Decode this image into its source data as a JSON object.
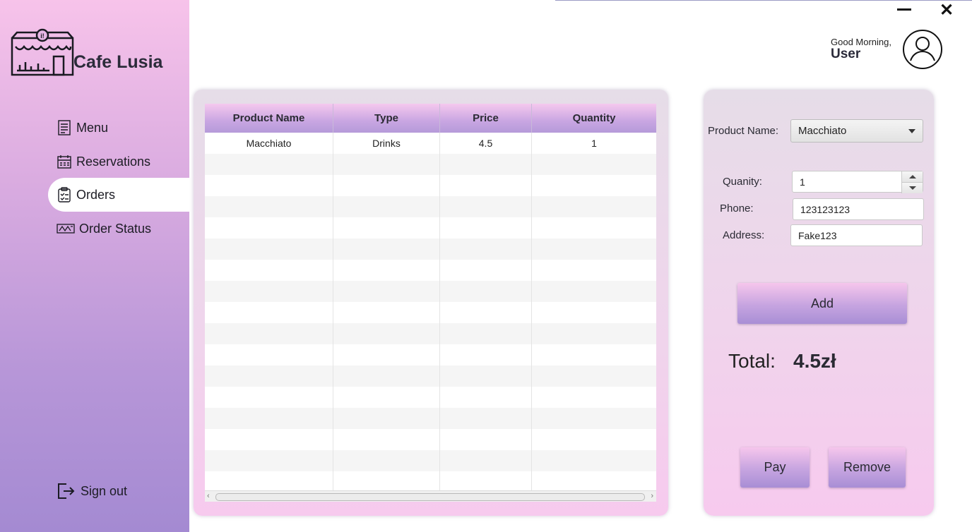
{
  "app": {
    "brand": "Cafe Lusia"
  },
  "sidebar": {
    "items": [
      {
        "label": "Menu",
        "icon": "menu-icon"
      },
      {
        "label": "Reservations",
        "icon": "calendar-icon"
      },
      {
        "label": "Orders",
        "icon": "clipboard-icon",
        "active": true
      },
      {
        "label": "Order Status",
        "icon": "status-icon"
      }
    ],
    "signout": "Sign out"
  },
  "header": {
    "greeting": "Good Morning,",
    "user": "User"
  },
  "table": {
    "columns": [
      "Product Name",
      "Type",
      "Price",
      "Quantity"
    ],
    "rows": [
      [
        "Macchiato",
        "Drinks",
        "4.5",
        "1"
      ]
    ]
  },
  "form": {
    "product_label": "Product Name:",
    "product_value": "Macchiato",
    "quantity_label": "Quanity:",
    "quantity_value": "1",
    "phone_label": "Phone:",
    "phone_value": "123123123",
    "address_label": "Address:",
    "address_value": "Fake123",
    "add_button": "Add",
    "total_label": "Total:",
    "total_value": "4.5zł",
    "pay_button": "Pay",
    "remove_button": "Remove"
  },
  "colors": {
    "sidebar_top": "#f7c3ea",
    "sidebar_bottom": "#a48ad2",
    "accent": "#b59ad9"
  }
}
